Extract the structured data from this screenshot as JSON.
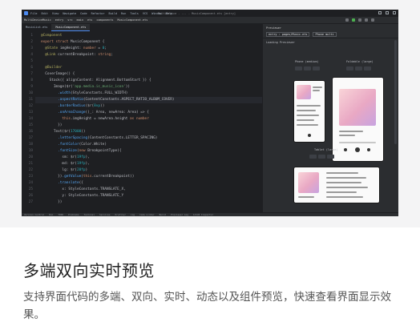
{
  "ide": {
    "menu": [
      "File",
      "Edit",
      "View",
      "Navigate",
      "Code",
      "Refactor",
      "Build",
      "Run",
      "Tools",
      "VCS",
      "Window",
      "Help"
    ],
    "window_title": "MultiDevice - ... - MusicComponent.ets [entry]",
    "breadcrumbs": [
      "MultiDeviceMusic",
      "entry",
      "src",
      "main",
      "ets",
      "components",
      "MusicComponent.ets"
    ],
    "tabs": [
      {
        "label": "MusicList.ets"
      },
      {
        "label": "MusicComponent.ets",
        "active": true
      }
    ],
    "line_numbers": [
      "1",
      "2",
      "3",
      "4",
      "5",
      "6",
      "7",
      "8",
      "9",
      "10",
      "11",
      "12",
      "13",
      "14",
      "15",
      "16",
      "17",
      "18",
      "19",
      "20",
      "21",
      "22",
      "23",
      "24",
      "25",
      "26",
      "27"
    ],
    "code": [
      "@Component",
      "export struct MusicComponent {",
      "  @State imgHeight: number = 0;",
      "  @Link currentBreakpoint: string;",
      "",
      "  @Builder",
      "  CoverImage() {",
      "    Stack({ alignContent: Alignment.BottomStart }) {",
      "      Image($r('app.media.ic_music_icon'))",
      "        .width(StyleConstants.FULL_WIDTH)",
      "        .aspectRatio(ContentConstants.ASPECT_RATIO_ALBUM_COVER)",
      "        .borderRadius($r(8vp))",
      "        .onAreaChange((_: Area, newArea: Area) => {",
      "          this.imgHeight = newArea.height as number",
      "        })",
      "      Text($r(17000))",
      "        .letterSpacing(ContentConstants.LETTER_SPACING)",
      "        .fontColor(Color.White)",
      "        .fontSize(new BreakpointType({",
      "          sm: $r(19fp),",
      "          md: $r(19fp),",
      "          lg: $r(20fp)",
      "        }).getValue(this.currentBreakpoint))",
      "        .translate({",
      "          x: StyleConstants.TRANSLATE_X,",
      "          y: StyleConstants.TRANSLATE_Y",
      "        })"
    ],
    "previewer": {
      "title": "Previewer",
      "toolbar_fields": [
        "entry : pages/Music.ets",
        "Phone multi"
      ],
      "profile_label": "Loading Previewer",
      "devices": {
        "phone_label": "Phone (medium)",
        "foldable_label": "Foldable (large)",
        "tablet_label": "Tablet (large)"
      }
    },
    "status_items": [
      "Version Control",
      "Run",
      "TODO",
      "Problems",
      "Terminal",
      "Services",
      "Profiler",
      "Log",
      "Code Linter",
      "Build",
      "Previewer Log",
      "ArkUI Inspector"
    ]
  },
  "card": {
    "title": "多端双向实时预览",
    "description": "支持界面代码的多端、双向、实时、动态以及组件预览，快速查看界面显示效果。"
  }
}
